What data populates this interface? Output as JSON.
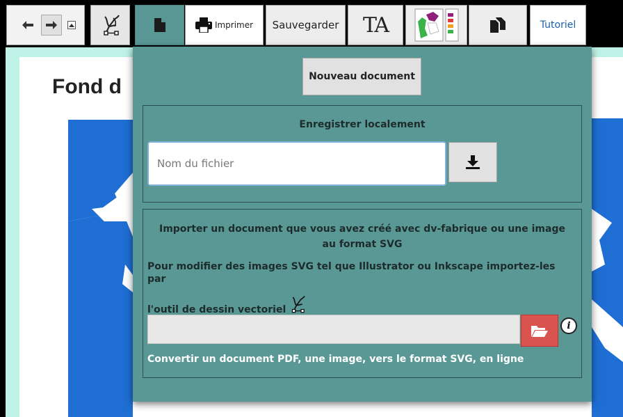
{
  "toolbar": {
    "icons": {
      "undo": "undo-arrow-icon",
      "redo": "redo-arrow-icon",
      "draw": "pen-nib-icon",
      "document": "file-icon",
      "print": "printer-icon",
      "text": "text-size-icon",
      "map": "map-legend-icon",
      "copy": "copy-files-icon"
    },
    "print_label": "Imprimer",
    "save_label": "Sauvegarder",
    "text_glyph": "TA",
    "tutorial_label": "Tutoriel"
  },
  "background": {
    "title": "Fond d"
  },
  "document_menu": {
    "new_document_label": "Nouveau document",
    "local_save": {
      "title": "Enregistrer localement",
      "filename_placeholder": "Nom du fichier",
      "download_icon": "download-icon"
    },
    "import": {
      "title": "Importer un document que vous avez créé avec dv-fabrique ou une image au format SVG",
      "note_line1": "Pour modifier des images SVG tel que Illustrator ou Inkscape importez-les par",
      "note_line2": "l'outil de dessin vectoriel",
      "browse_icon": "folder-open-icon",
      "info_icon_label": "i",
      "convert_link": "Convertir un document PDF, une image, vers le format SVG, en ligne"
    }
  },
  "colors": {
    "panel_bg": "#5a9896",
    "page_border": "#bff2e6",
    "map_blue": "#1f6ed4",
    "browse_red": "#d9534f",
    "link_color": "#1a5fa8"
  }
}
